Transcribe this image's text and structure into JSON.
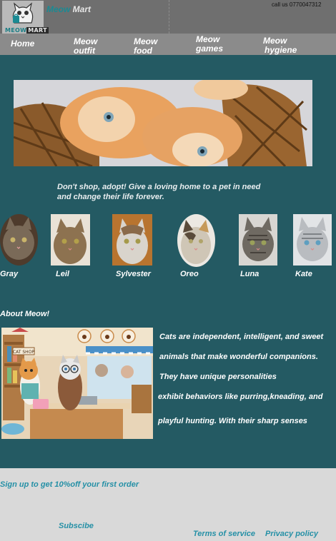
{
  "brand": {
    "logo_word1": "MEOW",
    "logo_word2": "MART",
    "name_part1": "Meow",
    "name_part2": " Mart"
  },
  "header": {
    "call": "call us 0770047312"
  },
  "nav": [
    {
      "line1": "Home",
      "line2": ""
    },
    {
      "line1": "Meow",
      "line2": "outfit"
    },
    {
      "line1": "Meow",
      "line2": "food"
    },
    {
      "line1": "Meow",
      "line2": "games"
    },
    {
      "line1": "Meow",
      "line2": "hygiene"
    }
  ],
  "tagline": "Don't shop, adopt! Give a loving home to a pet in need and change their life forever.",
  "cats": [
    {
      "name": "Gray",
      "fur": "#7a6a58"
    },
    {
      "name": "Leil",
      "fur": "#8d7250"
    },
    {
      "name": "Sylvester",
      "fur": "#d9d4cc"
    },
    {
      "name": "Oreo",
      "fur": "#cfc6b6"
    },
    {
      "name": "Luna",
      "fur": "#6f6a62"
    },
    {
      "name": "Kate",
      "fur": "#b9bcc0"
    }
  ],
  "about": {
    "title": "About Meow!",
    "lines": [
      "Cats are independent, intelligent, and sweet",
      "animals that make wonderful companions.",
      "They have unique personalities",
      "exhibit behaviors like purring,kneading, and",
      "playful hunting. With their sharp senses"
    ],
    "shop_sign": "CAT SHOP"
  },
  "footer": {
    "signup": "Sign up to get 10%off your first order",
    "subscribe": "Subscibe",
    "terms": "Terms of service",
    "privacy": "Privacy policy"
  }
}
